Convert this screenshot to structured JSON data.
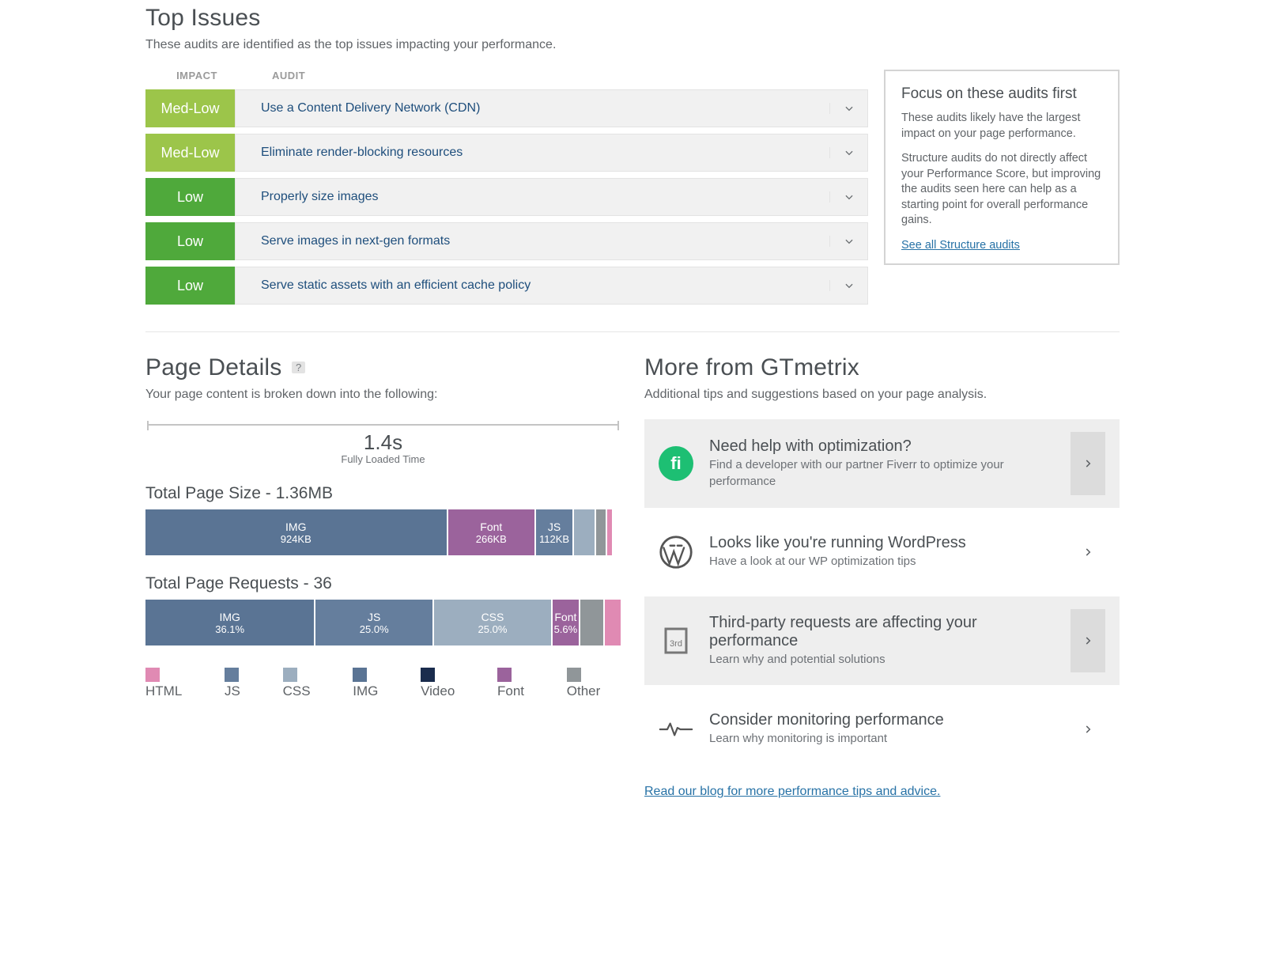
{
  "topIssues": {
    "title": "Top Issues",
    "subtitle": "These audits are identified as the top issues impacting your performance.",
    "head": {
      "impact": "IMPACT",
      "audit": "AUDIT"
    },
    "rows": [
      {
        "impact": "Med-Low",
        "impactClass": "impact-medlow",
        "label": "Use a Content Delivery Network (CDN)"
      },
      {
        "impact": "Med-Low",
        "impactClass": "impact-medlow",
        "label": "Eliminate render-blocking resources"
      },
      {
        "impact": "Low",
        "impactClass": "impact-low",
        "label": "Properly size images"
      },
      {
        "impact": "Low",
        "impactClass": "impact-low",
        "label": "Serve images in next-gen formats"
      },
      {
        "impact": "Low",
        "impactClass": "impact-low",
        "label": "Serve static assets with an efficient cache policy"
      }
    ]
  },
  "focus": {
    "title": "Focus on these audits first",
    "p1": "These audits likely have the largest impact on your page performance.",
    "p2": "Structure audits do not directly affect your Performance Score, but improving the audits seen here can help as a starting point for overall performance gains.",
    "link": "See all Structure audits"
  },
  "pageDetails": {
    "title": "Page Details",
    "help": "?",
    "subtitle": "Your page content is broken down into the following:",
    "time": {
      "value": "1.4s",
      "label": "Fully Loaded Time"
    },
    "size": {
      "title": "Total Page Size - 1.36MB",
      "segments": [
        {
          "l1": "IMG",
          "l2": "924KB",
          "pct": 64.6,
          "color": "#5a7494"
        },
        {
          "l1": "Font",
          "l2": "266KB",
          "pct": 18.6,
          "color": "#9b639c"
        },
        {
          "l1": "JS",
          "l2": "112KB",
          "pct": 7.8,
          "color": "#657e9d"
        },
        {
          "l1": "",
          "l2": "",
          "pct": 4.4,
          "color": "#9caebf"
        },
        {
          "l1": "",
          "l2": "",
          "pct": 2.1,
          "color": "#909699"
        },
        {
          "l1": "",
          "l2": "",
          "pct": 1.0,
          "color": "#e08ab3"
        },
        {
          "l1": "",
          "l2": "",
          "pct": 1.5,
          "color": "#ffffff"
        }
      ]
    },
    "requests": {
      "title": "Total Page Requests - 36",
      "segments": [
        {
          "l1": "IMG",
          "l2": "36.1%",
          "pct": 36.1,
          "color": "#5a7494"
        },
        {
          "l1": "JS",
          "l2": "25.0%",
          "pct": 25.0,
          "color": "#657e9d"
        },
        {
          "l1": "CSS",
          "l2": "25.0%",
          "pct": 25.0,
          "color": "#9caebf"
        },
        {
          "l1": "Font",
          "l2": "5.6%",
          "pct": 5.6,
          "color": "#9b639c"
        },
        {
          "l1": "",
          "l2": "",
          "pct": 5.0,
          "color": "#909699"
        },
        {
          "l1": "",
          "l2": "",
          "pct": 3.3,
          "color": "#e08ab3"
        }
      ]
    },
    "legend": [
      {
        "label": "HTML",
        "color": "#e08ab3"
      },
      {
        "label": "JS",
        "color": "#657e9d"
      },
      {
        "label": "CSS",
        "color": "#9caebf"
      },
      {
        "label": "IMG",
        "color": "#5a7494"
      },
      {
        "label": "Video",
        "color": "#1a2c4d"
      },
      {
        "label": "Font",
        "color": "#9b639c"
      },
      {
        "label": "Other",
        "color": "#909699"
      }
    ]
  },
  "more": {
    "title": "More from GTmetrix",
    "subtitle": "Additional tips and suggestions based on your page analysis.",
    "tips": [
      {
        "title": "Need help with optimization?",
        "desc": "Find a developer with our partner Fiverr to optimize your performance",
        "alt": true,
        "icon": "fiverr"
      },
      {
        "title": "Looks like you're running WordPress",
        "desc": "Have a look at our WP optimization tips",
        "alt": false,
        "icon": "wordpress"
      },
      {
        "title": "Third-party requests are affecting your performance",
        "desc": "Learn why and potential solutions",
        "alt": true,
        "icon": "thirdparty"
      },
      {
        "title": "Consider monitoring performance",
        "desc": "Learn why monitoring is important",
        "alt": false,
        "icon": "monitor"
      }
    ],
    "blogLink": "Read our blog for more performance tips and advice."
  },
  "chart_data": [
    {
      "type": "bar",
      "title": "Total Page Size - 1.36MB",
      "categories": [
        "IMG",
        "Font",
        "JS",
        "CSS",
        "Other",
        "HTML"
      ],
      "values_kb": [
        924,
        266,
        112,
        60,
        29,
        14
      ],
      "total_label": "1.36MB"
    },
    {
      "type": "bar",
      "title": "Total Page Requests - 36",
      "categories": [
        "IMG",
        "JS",
        "CSS",
        "Font",
        "Other",
        "HTML"
      ],
      "values_pct": [
        36.1,
        25.0,
        25.0,
        5.6,
        5.0,
        3.3
      ],
      "total": 36
    }
  ]
}
